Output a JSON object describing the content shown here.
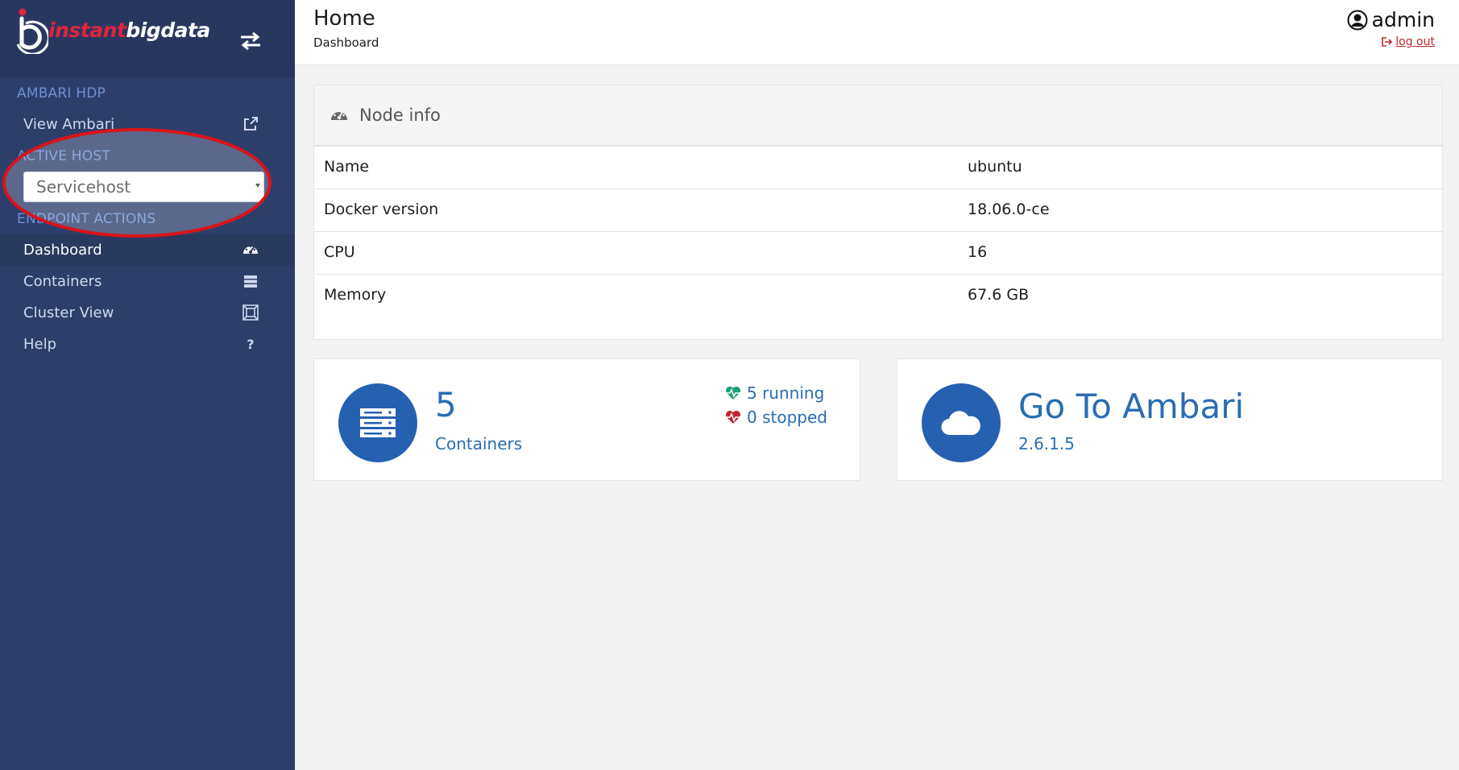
{
  "brand": {
    "part1": "instant",
    "part2": "bigdata",
    "accent": "#e0243a"
  },
  "sidebar": {
    "section_ambari": "AMBARI HDP",
    "view_ambari": {
      "label": "View Ambari",
      "icon": "external-link-icon"
    },
    "section_active_host": "ACTIVE HOST",
    "active_host": "Servicehost",
    "section_endpoint": "ENDPOINT ACTIONS",
    "items": [
      {
        "label": "Dashboard",
        "icon": "dashboard-icon",
        "active": true
      },
      {
        "label": "Containers",
        "icon": "containers-icon",
        "active": false
      },
      {
        "label": "Cluster View",
        "icon": "cluster-view-icon",
        "active": false
      },
      {
        "label": "Help",
        "icon": "help-icon",
        "glyph": "?",
        "active": false
      }
    ]
  },
  "header": {
    "title": "Home",
    "subtitle": "Dashboard",
    "user": "admin",
    "logout": "log out"
  },
  "node_info": {
    "title": "Node info",
    "rows": [
      {
        "key": "Name",
        "value": "ubuntu"
      },
      {
        "key": "Docker version",
        "value": "18.06.0-ce"
      },
      {
        "key": "CPU",
        "value": "16"
      },
      {
        "key": "Memory",
        "value": "67.6 GB"
      }
    ]
  },
  "containers_card": {
    "count": "5",
    "label": "Containers",
    "running": "5 running",
    "stopped": "0 stopped"
  },
  "ambari_card": {
    "title": "Go To Ambari",
    "version": "2.6.1.5"
  },
  "colors": {
    "sidebar_bg": "#2e3e6b",
    "accent_blue": "#2660b0",
    "running_green": "#1aa17a",
    "stopped_red": "#c0262c",
    "annotation_red": "#d9141b"
  }
}
